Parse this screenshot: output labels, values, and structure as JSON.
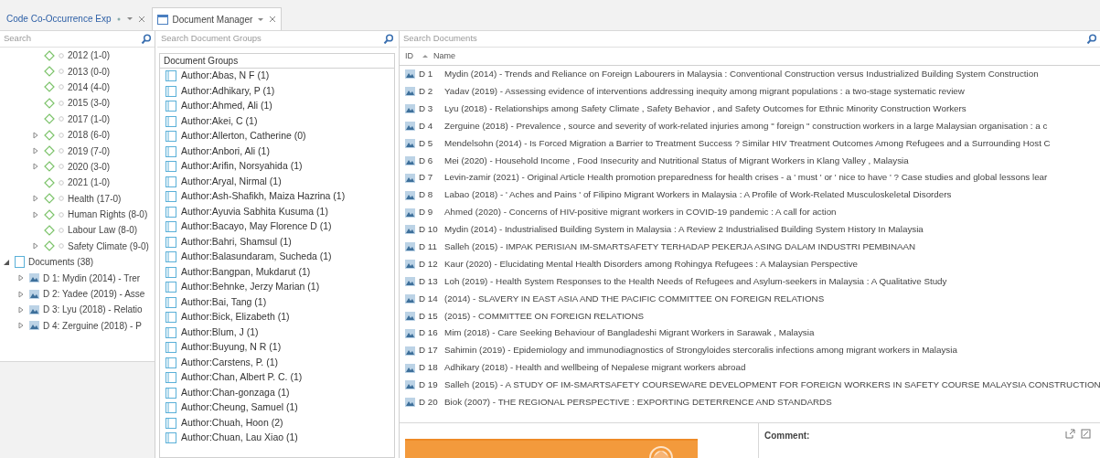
{
  "tabs": [
    {
      "title": "Code Co-Occurrence Exp",
      "selected": false,
      "kind": "plain"
    },
    {
      "title": "Document Manager",
      "selected": true,
      "kind": "window"
    }
  ],
  "code_panel": {
    "search_placeholder": "Search",
    "tree": [
      {
        "label": "2012 (1-0)",
        "kind": "code"
      },
      {
        "label": "2013 (0-0)",
        "kind": "code"
      },
      {
        "label": "2014 (4-0)",
        "kind": "code"
      },
      {
        "label": "2015 (3-0)",
        "kind": "code"
      },
      {
        "label": "2017 (1-0)",
        "kind": "code"
      },
      {
        "label": "2018 (6-0)",
        "kind": "code",
        "expanded": false
      },
      {
        "label": "2019 (7-0)",
        "kind": "code",
        "expanded": false
      },
      {
        "label": "2020 (3-0)",
        "kind": "code",
        "expanded": false
      },
      {
        "label": "2021 (1-0)",
        "kind": "code"
      },
      {
        "label": "Health (17-0)",
        "kind": "code",
        "expanded": false
      },
      {
        "label": "Human Rights (8-0)",
        "kind": "code",
        "expanded": false
      },
      {
        "label": "Labour Law (8-0)",
        "kind": "code"
      },
      {
        "label": "Safety Climate (9-0)",
        "kind": "code",
        "expanded": false
      },
      {
        "label": "Documents (38)",
        "kind": "group",
        "expanded": true,
        "children": [
          {
            "label": "D 1: Mydin (2014) - Trer",
            "kind": "document",
            "expanded": false
          },
          {
            "label": "D 2: Yadee (2019) - Asse",
            "kind": "document",
            "expanded": false
          },
          {
            "label": "D 3: Lyu (2018) - Relatio",
            "kind": "document",
            "expanded": false
          },
          {
            "label": "D 4: Zerguine (2018) - P",
            "kind": "document",
            "expanded": false
          }
        ]
      }
    ]
  },
  "groups_panel": {
    "search_placeholder": "Search Document Groups",
    "header": "Document Groups",
    "groups": [
      "Author:Abas, N F (1)",
      "Author:Adhikary, P (1)",
      "Author:Ahmed, Ali (1)",
      "Author:Akei, C (1)",
      "Author:Allerton, Catherine (0)",
      "Author:Anbori, Ali (1)",
      "Author:Arifin, Norsyahida (1)",
      "Author:Aryal, Nirmal (1)",
      "Author:Ash-Shafikh, Maiza Hazrina (1)",
      "Author:Ayuvia Sabhita Kusuma (1)",
      "Author:Bacayo, May Florence D (1)",
      "Author:Bahri, Shamsul (1)",
      "Author:Balasundaram, Sucheda (1)",
      "Author:Bangpan, Mukdarut (1)",
      "Author:Behnke, Jerzy Marian (1)",
      "Author:Bai, Tang (1)",
      "Author:Bick, Elizabeth (1)",
      "Author:Blum, J (1)",
      "Author:Buyung, N R (1)",
      "Author:Carstens, P. (1)",
      "Author:Chan, Albert P. C. (1)",
      "Author:Chan-gonzaga (1)",
      "Author:Cheung, Samuel (1)",
      "Author:Chuah, Hoon (2)",
      "Author:Chuan, Lau Xiao (1)"
    ]
  },
  "documents_panel": {
    "search_placeholder": "Search Documents",
    "columns": [
      "ID",
      "Name"
    ],
    "rows": [
      {
        "id": "D 1",
        "name": "Mydin (2014) - Trends and Reliance on Foreign Labourers in Malaysia : Conventional Construction versus Industrialized Building System Construction"
      },
      {
        "id": "D 2",
        "name": "Yadav (2019) - Assessing evidence of interventions addressing inequity among migrant populations : a two-stage systematic review"
      },
      {
        "id": "D 3",
        "name": "Lyu (2018) - Relationships among Safety Climate , Safety Behavior , and Safety Outcomes for Ethnic Minority Construction Workers"
      },
      {
        "id": "D 4",
        "name": "Zerguine (2018) - Prevalence , source and severity of work-related injuries among \" foreign \" construction workers in a large Malaysian organisation : a c"
      },
      {
        "id": "D 5",
        "name": "Mendelsohn (2014) - Is Forced Migration a Barrier to Treatment Success ? Similar HIV Treatment Outcomes Among Refugees and a Surrounding Host C"
      },
      {
        "id": "D 6",
        "name": "Mei (2020) - Household Income , Food Insecurity and Nutritional Status of Migrant Workers in Klang Valley , Malaysia"
      },
      {
        "id": "D 7",
        "name": "Levin-zamir (2021) - Original Article Health promotion preparedness for health crises - a ' must ' or ' nice to have ' ? Case studies and global lessons lear"
      },
      {
        "id": "D 8",
        "name": "Labao (2018) - ' Aches and Pains ' of Filipino Migrant Workers in Malaysia : A Profile of Work-Related Musculoskeletal Disorders"
      },
      {
        "id": "D 9",
        "name": "Ahmed (2020) - Concerns of HIV-positive migrant workers in COVID-19 pandemic : A call for action"
      },
      {
        "id": "D 10",
        "name": "Mydin (2014) - Industrialised Building System in Malaysia : A Review 2 Industrialised Building System History In Malaysia"
      },
      {
        "id": "D 11",
        "name": "Salleh (2015) - IMPAK PERISIAN IM-SMARTSAFETY TERHADAP PEKERJA ASING DALAM INDUSTRI PEMBINAAN"
      },
      {
        "id": "D 12",
        "name": "Kaur (2020) - Elucidating Mental Health Disorders among Rohingya Refugees : A Malaysian Perspective"
      },
      {
        "id": "D 13",
        "name": "Loh (2019) - Health System Responses to the Health Needs of Refugees and Asylum-seekers in Malaysia : A Qualitative Study"
      },
      {
        "id": "D 14",
        "name": "(2014) - SLAVERY IN EAST ASIA AND THE PACIFIC COMMITTEE ON FOREIGN RELATIONS"
      },
      {
        "id": "D 15",
        "name": "(2015) - COMMITTEE ON FOREIGN RELATIONS"
      },
      {
        "id": "D 16",
        "name": "Mim (2018) - Care Seeking Behaviour of Bangladeshi Migrant Workers in Sarawak , Malaysia"
      },
      {
        "id": "D 17",
        "name": "Sahimin (2019) - Epidemiology and immunodiagnostics of Strongyloides stercoralis infections among migrant workers in Malaysia"
      },
      {
        "id": "D 18",
        "name": "Adhikary (2018) - Health and wellbeing of Nepalese migrant workers abroad"
      },
      {
        "id": "D 19",
        "name": "Salleh (2015) - A STUDY OF IM-SMARTSAFETY COURSEWARE DEVELOPMENT FOR FOREIGN WORKERS IN SAFETY COURSE MALAYSIA CONSTRUCTION"
      },
      {
        "id": "D 20",
        "name": "Biok (2007) - THE REGIONAL PERSPECTIVE : EXPORTING DETERRENCE AND STANDARDS"
      }
    ]
  },
  "comment": {
    "label": "Comment:"
  }
}
